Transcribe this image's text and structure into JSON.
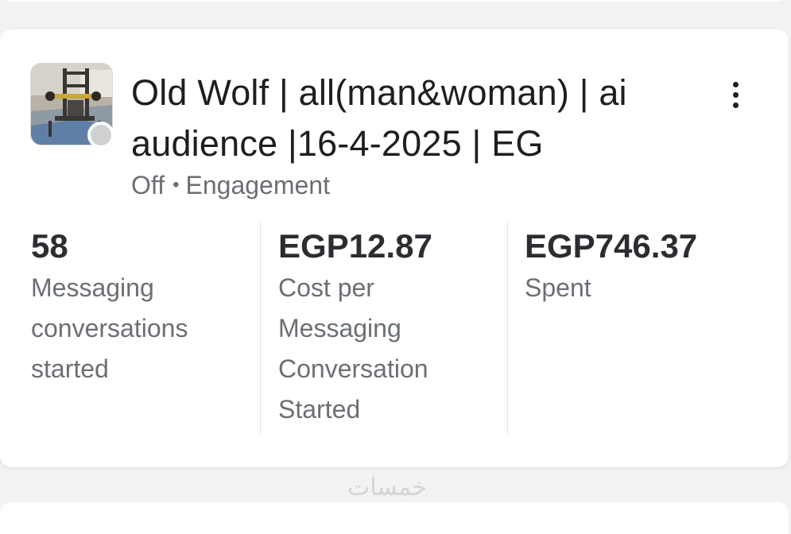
{
  "campaign": {
    "title": "Old Wolf | all(man&woman) | ai audience |16-4-2025 | EG",
    "status": "Off",
    "separator": "•",
    "objective": "Engagement"
  },
  "metrics": [
    {
      "value": "58",
      "label": "Messaging conversations started"
    },
    {
      "value": "EGP12.87",
      "label": "Cost per Messaging Conversation Started"
    },
    {
      "value": "EGP746.37",
      "label": "Spent"
    }
  ],
  "watermark": "خمسات",
  "colors": {
    "status_dot": "#cfd0d2",
    "text_primary": "#1c1e21",
    "text_secondary": "#6b6f74"
  },
  "icons": {
    "more": "more-vertical-icon",
    "status": "status-dot"
  }
}
